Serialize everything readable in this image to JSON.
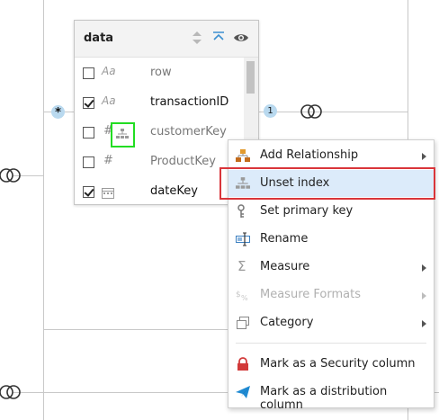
{
  "table": {
    "title": "data",
    "fields": [
      {
        "type_glyph": "Aa",
        "name": "row",
        "checked": false,
        "style": "dim"
      },
      {
        "type_glyph": "Aa",
        "name": "transactionID",
        "checked": true,
        "style": "strong"
      },
      {
        "type_glyph": "#",
        "name": "customerKey",
        "checked": false,
        "style": "dim",
        "index_icon": "hierarchy-icon"
      },
      {
        "type_glyph": "#",
        "name": "ProductKey",
        "checked": false,
        "style": "dim"
      },
      {
        "type_glyph": "calendar",
        "name": "dateKey",
        "checked": true,
        "style": "strong"
      }
    ]
  },
  "relationships": {
    "left_cardinality": "*",
    "right_cardinality": "1"
  },
  "context_menu": {
    "items": [
      {
        "label": "Add Relationship",
        "icon": "relationship-icon",
        "submenu": true,
        "disabled": false
      },
      {
        "label": "Unset index",
        "icon": "hierarchy-icon",
        "submenu": false,
        "disabled": false,
        "selected": true
      },
      {
        "label": "Set primary key",
        "icon": "key-icon",
        "submenu": false,
        "disabled": false
      },
      {
        "label": "Rename",
        "icon": "rename-icon",
        "submenu": false,
        "disabled": false
      },
      {
        "label": "Measure",
        "icon": "sigma-icon",
        "submenu": true,
        "disabled": false
      },
      {
        "label": "Measure Formats",
        "icon": "format-icon",
        "submenu": true,
        "disabled": true
      },
      {
        "label": "Category",
        "icon": "category-icon",
        "submenu": true,
        "disabled": false
      },
      {
        "label": "Mark as a Security column",
        "icon": "lock-icon",
        "submenu": false,
        "disabled": false
      },
      {
        "label": "Mark as a distribution column",
        "icon": "send-icon",
        "submenu": false,
        "disabled": false
      }
    ]
  },
  "colors": {
    "accent_blue": "#1f8ad2",
    "selected_bg": "#dcebfa",
    "highlight_red": "#d9353a",
    "highlight_green": "#22dd22",
    "lock_red": "#d23a3a"
  }
}
